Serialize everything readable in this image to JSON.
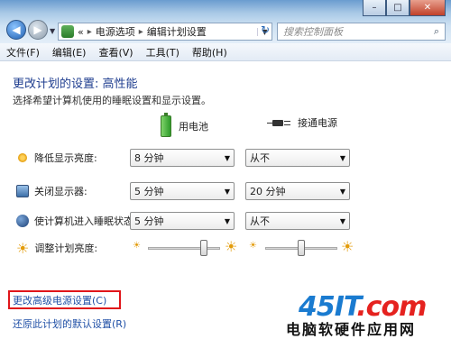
{
  "window": {
    "minimize_glyph": "–",
    "maximize_glyph": "□",
    "close_glyph": "✕"
  },
  "nav": {
    "back_glyph": "◀",
    "forward_glyph": "▶",
    "dropdown_glyph": "▼"
  },
  "address": {
    "chevron": "«",
    "crumbs": [
      "电源选项",
      "编辑计划设置"
    ],
    "separator": "▸",
    "dropdown_glyph": "▼",
    "refresh_glyph": "↻"
  },
  "search": {
    "placeholder": "搜索控制面板",
    "icon_glyph": "⌕"
  },
  "menu": [
    "文件(F)",
    "编辑(E)",
    "查看(V)",
    "工具(T)",
    "帮助(H)"
  ],
  "page": {
    "title": "更改计划的设置: 高性能",
    "description": "选择希望计算机使用的睡眠设置和显示设置。",
    "col_battery": "用电池",
    "col_plugged": "接通电源"
  },
  "settings": [
    {
      "label": "降低显示亮度:",
      "battery": "8 分钟",
      "plugged": "从不"
    },
    {
      "label": "关闭显示器:",
      "battery": "5 分钟",
      "plugged": "20 分钟"
    },
    {
      "label": "使计算机进入睡眠状态:",
      "battery": "5 分钟",
      "plugged": "从不"
    }
  ],
  "brightness": {
    "label": "调整计划亮度:",
    "battery_level": 0.78,
    "plugged_level": 0.5,
    "sun_glyph": "☀"
  },
  "links": {
    "advanced": "更改高级电源设置(C)",
    "restore": "还原此计划的默认设置(R)"
  },
  "watermark": {
    "logo_main": "45IT",
    "logo_tail": ".com",
    "caption": "电脑软硬件应用网"
  },
  "colors": {
    "title": "#1e3d8f",
    "link": "#1f4fa6",
    "highlight": "#e0161a"
  }
}
